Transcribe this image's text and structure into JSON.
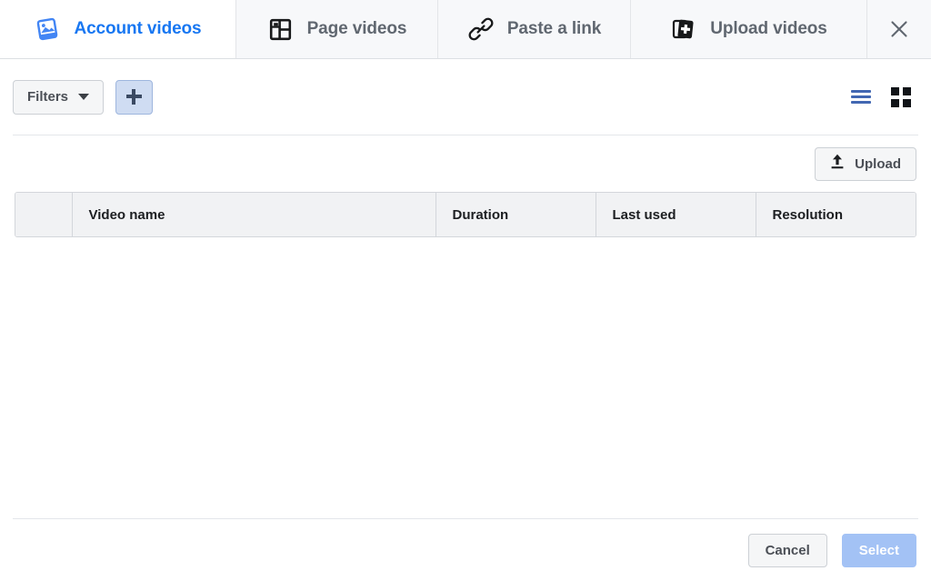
{
  "tabs": [
    {
      "id": "account-videos",
      "label": "Account videos",
      "icon": "photo-card-icon",
      "active": true
    },
    {
      "id": "page-videos",
      "label": "Page videos",
      "icon": "page-layout-icon",
      "active": false
    },
    {
      "id": "paste-link",
      "label": "Paste a link",
      "icon": "link-chain-icon",
      "active": false
    },
    {
      "id": "upload-videos",
      "label": "Upload videos",
      "icon": "stacked-cards-plus-icon",
      "active": false
    }
  ],
  "close_button": {
    "icon": "close-icon",
    "label": ""
  },
  "toolbar": {
    "filters_label": "Filters",
    "filters_icon": "chevron-down-icon",
    "add_filter_icon": "plus-icon",
    "list_view_icon": "list-view-icon",
    "grid_view_icon": "grid-view-icon",
    "active_view": "list"
  },
  "upload": {
    "label": "Upload",
    "icon": "upload-arrow-icon"
  },
  "table": {
    "columns": [
      {
        "key": "checkbox",
        "label": ""
      },
      {
        "key": "name",
        "label": "Video name"
      },
      {
        "key": "duration",
        "label": "Duration"
      },
      {
        "key": "last_used",
        "label": "Last used"
      },
      {
        "key": "resolution",
        "label": "Resolution"
      }
    ],
    "rows": []
  },
  "footer": {
    "cancel_label": "Cancel",
    "select_label": "Select"
  },
  "colors": {
    "accent_blue": "#1877f2",
    "list_icon_blue": "#4267b2",
    "plus_button_bg": "#cfdcf2",
    "select_button_bg": "#a3c2f5",
    "tabbar_bg": "#f7f8fa",
    "table_header_bg": "#f1f2f4"
  }
}
